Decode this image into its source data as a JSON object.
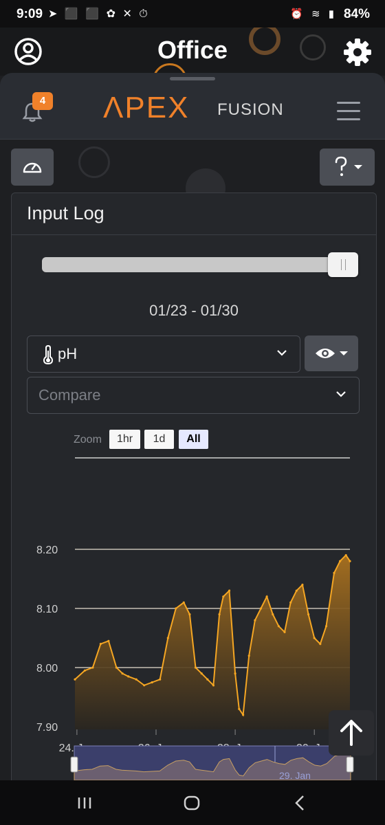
{
  "status_bar": {
    "time": "9:09",
    "left_icons": "➤ ⬛ ⬛ ✿ ✕ ⏱",
    "right_icons": "⏰ ≋ ▮",
    "battery": "84%"
  },
  "title_bar": {
    "title": "Office",
    "profile_icon": "account-circle-icon",
    "settings_icon": "gear-icon"
  },
  "app_header": {
    "notification_count": "4",
    "logo_main": "ΛPEX",
    "logo_sub": "FUSION"
  },
  "input_log": {
    "title": "Input Log",
    "date_range": "01/23 - 01/30",
    "input_select": "pH",
    "compare_placeholder": "Compare",
    "zoom_label": "Zoom",
    "zoom_buttons": [
      "1hr",
      "1d",
      "All"
    ],
    "zoom_selected": "All"
  },
  "chart_data": {
    "type": "area",
    "title": "",
    "xlabel": "",
    "ylabel": "",
    "ylim": [
      7.9,
      8.2
    ],
    "y_ticks": [
      "8.20",
      "8.10",
      "8.00",
      "7.90"
    ],
    "x_ticks": [
      "24. Jan",
      "26. Jan",
      "28. Jan",
      "30. Jan"
    ],
    "navigator_label": "29. Jan",
    "grid": true,
    "series_color": "#f5a623",
    "x": [
      23.95,
      24.2,
      24.4,
      24.6,
      24.8,
      25.0,
      25.15,
      25.3,
      25.5,
      25.7,
      25.9,
      26.1,
      26.3,
      26.5,
      26.7,
      26.85,
      27.0,
      27.15,
      27.3,
      27.45,
      27.6,
      27.7,
      27.85,
      28.0,
      28.1,
      28.2,
      28.35,
      28.5,
      28.65,
      28.8,
      28.95,
      29.1,
      29.25,
      29.4,
      29.55,
      29.7,
      29.85,
      30.0,
      30.15,
      30.3,
      30.5,
      30.65,
      30.8,
      30.9
    ],
    "values": [
      7.98,
      7.995,
      8.0,
      8.04,
      8.045,
      8.0,
      7.99,
      7.985,
      7.98,
      7.97,
      7.975,
      7.98,
      8.05,
      8.1,
      8.11,
      8.09,
      8.0,
      7.99,
      7.98,
      7.97,
      8.09,
      8.12,
      8.13,
      7.99,
      7.93,
      7.92,
      8.02,
      8.08,
      8.1,
      8.12,
      8.09,
      8.07,
      8.06,
      8.11,
      8.13,
      8.14,
      8.09,
      8.05,
      8.04,
      8.07,
      8.16,
      8.18,
      8.19,
      8.18
    ]
  }
}
